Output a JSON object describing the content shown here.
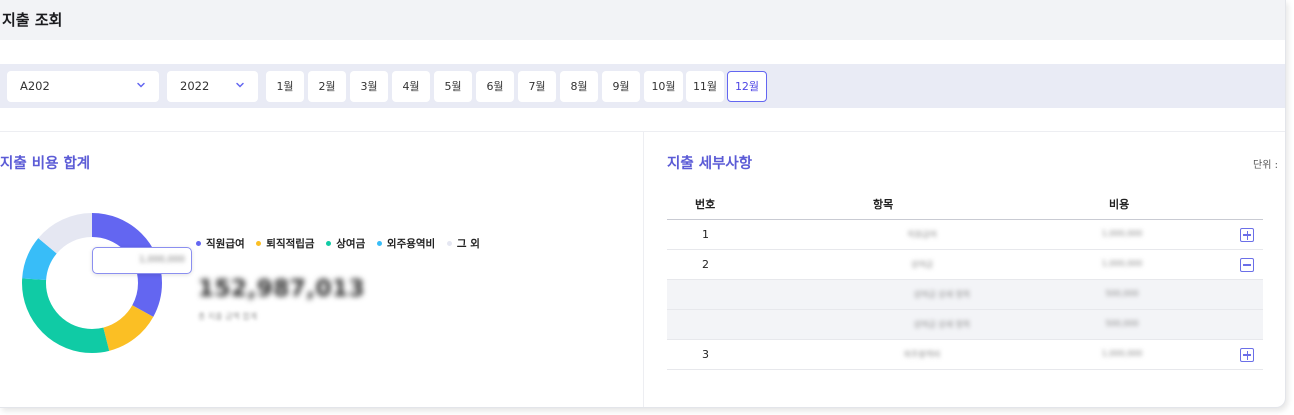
{
  "page": {
    "title": "지출 조회"
  },
  "filters": {
    "store": {
      "value": "A202"
    },
    "year": {
      "value": "2022"
    },
    "months": [
      "1월",
      "2월",
      "3월",
      "4월",
      "5월",
      "6월",
      "7월",
      "8월",
      "9월",
      "10월",
      "11월",
      "12월"
    ],
    "selected_month": "12월"
  },
  "summary": {
    "title": "지출 비용 합계",
    "total": "152,987,013",
    "legend": [
      {
        "label": "직원급여",
        "color": "#6366f1",
        "value": 0.33
      },
      {
        "label": "퇴직적립금",
        "color": "#fbbf24",
        "value": 0.13
      },
      {
        "label": "상여금",
        "color": "#10cba5",
        "value": 0.3
      },
      {
        "label": "외주용역비",
        "color": "#38bdf8",
        "value": 0.1
      },
      {
        "label": "그 외",
        "color": "#e5e7f2",
        "value": 0.14
      }
    ]
  },
  "details": {
    "title": "지출 세부사항",
    "unit": "단위 :",
    "columns": {
      "no": "번호",
      "item": "항목",
      "cost": "비용"
    },
    "rows": [
      {
        "no": "1",
        "expand": "plus"
      },
      {
        "no": "2",
        "expand": "minus"
      },
      {
        "no": "",
        "sub": true
      },
      {
        "no": "",
        "sub": true
      },
      {
        "no": "3",
        "expand": "plus"
      }
    ]
  }
}
